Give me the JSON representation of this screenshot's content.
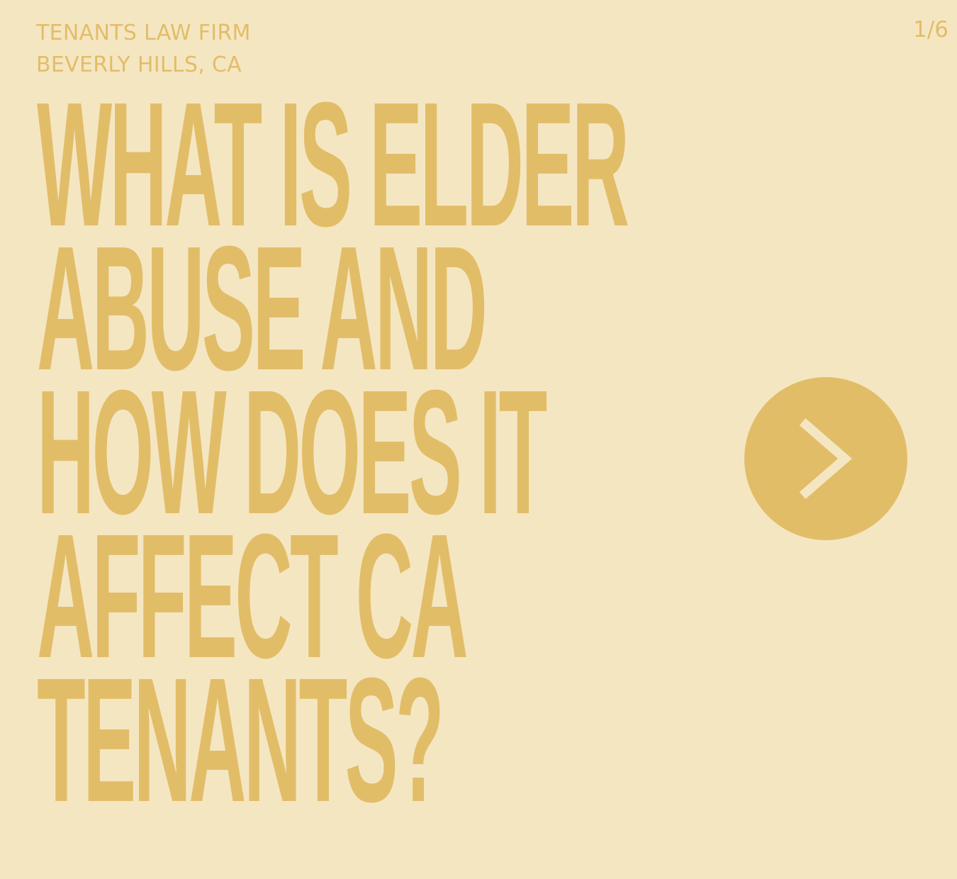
{
  "header": {
    "firm_name": "TENANTS LAW FIRM",
    "location": "BEVERLY HILLS, CA",
    "page_indicator": "1/6"
  },
  "headline": {
    "lines": [
      "WHAT IS ELDER",
      "ABUSE AND",
      "HOW DOES IT",
      "AFFECT CA",
      "TENANTS?"
    ]
  },
  "next_button": {
    "icon": "chevron-right-icon"
  },
  "colors": {
    "background": "#f5e6c2",
    "accent": "#e2bd68",
    "icon": "#f5e6c2"
  }
}
